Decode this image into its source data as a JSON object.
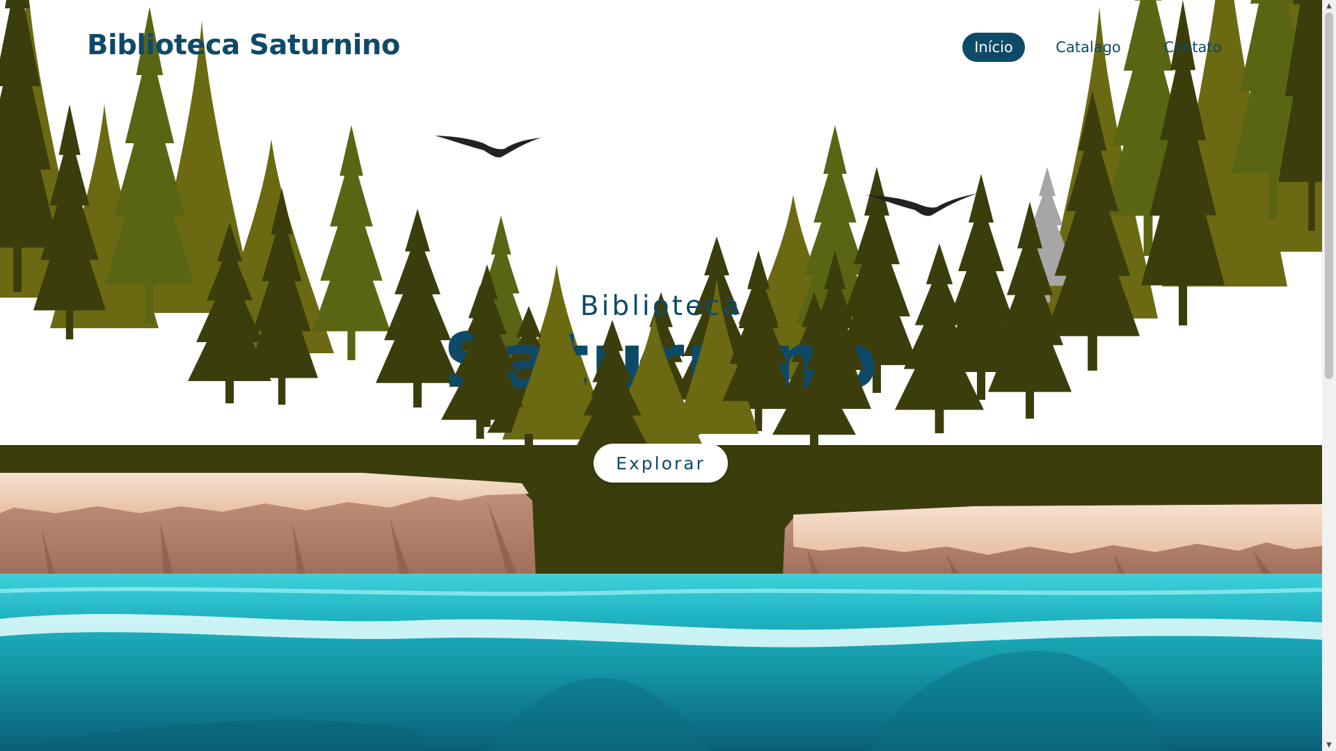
{
  "brand": {
    "title": "Biblioteca Saturnino"
  },
  "nav": {
    "items": [
      {
        "label": "Início",
        "active": true
      },
      {
        "label": "Catalago",
        "active": false
      },
      {
        "label": "Contato",
        "active": false
      }
    ]
  },
  "hero": {
    "subtitle": "Biblioteca",
    "title": "Saturnino",
    "button_label": "Explorar"
  },
  "icons": {
    "scroll_up": "scroll-up-arrow-icon",
    "scroll_down": "scroll-down-arrow-icon",
    "birds": "bird-icon"
  },
  "colors": {
    "brand": "#0e4a68",
    "forest_light": "#6b6a12",
    "forest_dark": "#3a3a0c",
    "water": "#1b9cad",
    "cliff": "#b68573",
    "sand": "#f1d3bd"
  }
}
